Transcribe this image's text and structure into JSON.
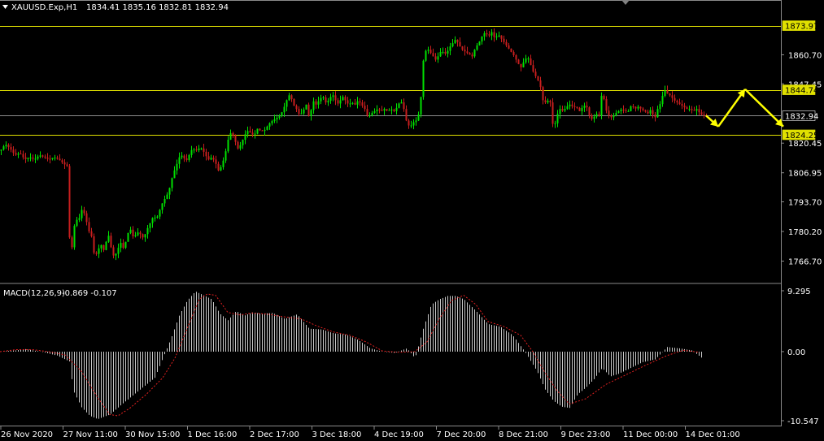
{
  "chart_header": {
    "symbol_info": "XAUUSD.Exp,H1",
    "ohlc": "1834.41 1835.16 1832.81 1832.94"
  },
  "indicator_header": {
    "label": "MACD(12,26,9)",
    "values": "-0.869 -0.107"
  },
  "colors": {
    "background": "#000000",
    "bull": "#00e000",
    "bear": "#c81e1e",
    "level_line": "#e0e000",
    "price_line": "#8a8a8a",
    "arrow": "#ffff00",
    "macd_hist": "#c8c8c8",
    "macd_signal": "#e02020",
    "axis_text": "#ffffff"
  },
  "chart_data": [
    {
      "type": "candlestick",
      "title": "XAUUSD.Exp,H1",
      "ylim": [
        1758,
        1879
      ],
      "y_ticks": [
        "1860.70",
        "1847.45",
        "1820.45",
        "1806.95",
        "1793.70",
        "1780.20",
        "1766.70"
      ],
      "x_ticks": [
        "26 Nov 2020",
        "27 Nov 11:00",
        "30 Nov 15:00",
        "1 Dec 16:00",
        "2 Dec 17:00",
        "3 Dec 18:00",
        "4 Dec 19:00",
        "7 Dec 20:00",
        "8 Dec 21:00",
        "9 Dec 23:00",
        "11 Dec 00:00",
        "14 Dec 01:00"
      ],
      "level_tags": [
        {
          "label": "1873.97",
          "value": 1873.97,
          "style": "level"
        },
        {
          "label": "1844.74",
          "value": 1844.74,
          "style": "level"
        },
        {
          "label": "1832.94",
          "value": 1832.94,
          "style": "current"
        },
        {
          "label": "1824.25",
          "value": 1824.25,
          "style": "level"
        }
      ],
      "price_path": [
        [
          0,
          1817
        ],
        [
          6,
          1820
        ],
        [
          12,
          1818
        ],
        [
          18,
          1815
        ],
        [
          24,
          1816
        ],
        [
          30,
          1813
        ],
        [
          36,
          1814
        ],
        [
          42,
          1813
        ],
        [
          48,
          1815
        ],
        [
          54,
          1814
        ],
        [
          60,
          1813
        ],
        [
          66,
          1814
        ],
        [
          72,
          1813
        ],
        [
          78,
          1811
        ],
        [
          82,
          1810
        ],
        [
          84,
          1779
        ],
        [
          88,
          1773
        ],
        [
          92,
          1786
        ],
        [
          96,
          1785
        ],
        [
          100,
          1790
        ],
        [
          104,
          1788
        ],
        [
          108,
          1781
        ],
        [
          112,
          1778
        ],
        [
          116,
          1768
        ],
        [
          120,
          1772
        ],
        [
          124,
          1774
        ],
        [
          128,
          1771
        ],
        [
          132,
          1780
        ],
        [
          136,
          1773
        ],
        [
          140,
          1768
        ],
        [
          144,
          1772
        ],
        [
          148,
          1775
        ],
        [
          152,
          1772
        ],
        [
          156,
          1779
        ],
        [
          160,
          1781
        ],
        [
          164,
          1777
        ],
        [
          168,
          1780
        ],
        [
          172,
          1779
        ],
        [
          176,
          1777
        ],
        [
          180,
          1781
        ],
        [
          184,
          1784
        ],
        [
          188,
          1787
        ],
        [
          192,
          1786
        ],
        [
          196,
          1790
        ],
        [
          200,
          1794
        ],
        [
          204,
          1796
        ],
        [
          208,
          1800
        ],
        [
          212,
          1806
        ],
        [
          216,
          1810
        ],
        [
          220,
          1814
        ],
        [
          224,
          1815
        ],
        [
          228,
          1812
        ],
        [
          232,
          1815
        ],
        [
          236,
          1818
        ],
        [
          240,
          1817
        ],
        [
          244,
          1818
        ],
        [
          248,
          1818
        ],
        [
          252,
          1815
        ],
        [
          256,
          1813
        ],
        [
          260,
          1814
        ],
        [
          264,
          1812
        ],
        [
          268,
          1808
        ],
        [
          272,
          1810
        ],
        [
          276,
          1815
        ],
        [
          280,
          1822
        ],
        [
          284,
          1826
        ],
        [
          288,
          1822
        ],
        [
          292,
          1818
        ],
        [
          296,
          1820
        ],
        [
          300,
          1824
        ],
        [
          304,
          1826
        ],
        [
          308,
          1825
        ],
        [
          312,
          1824
        ],
        [
          316,
          1827
        ],
        [
          320,
          1826
        ],
        [
          324,
          1826
        ],
        [
          328,
          1828
        ],
        [
          332,
          1830
        ],
        [
          336,
          1831
        ],
        [
          340,
          1832
        ],
        [
          344,
          1833
        ],
        [
          348,
          1836
        ],
        [
          352,
          1840
        ],
        [
          356,
          1843
        ],
        [
          360,
          1838
        ],
        [
          364,
          1836
        ],
        [
          368,
          1833
        ],
        [
          372,
          1835
        ],
        [
          376,
          1838
        ],
        [
          380,
          1831
        ],
        [
          384,
          1840
        ],
        [
          388,
          1838
        ],
        [
          392,
          1840
        ],
        [
          396,
          1842
        ],
        [
          400,
          1839
        ],
        [
          404,
          1840
        ],
        [
          408,
          1843
        ],
        [
          412,
          1840
        ],
        [
          416,
          1838
        ],
        [
          420,
          1842
        ],
        [
          424,
          1840
        ],
        [
          428,
          1838
        ],
        [
          432,
          1839
        ],
        [
          436,
          1838
        ],
        [
          440,
          1840
        ],
        [
          444,
          1838
        ],
        [
          448,
          1836
        ],
        [
          452,
          1832
        ],
        [
          456,
          1834
        ],
        [
          460,
          1835
        ],
        [
          464,
          1836
        ],
        [
          468,
          1835
        ],
        [
          472,
          1836
        ],
        [
          476,
          1835
        ],
        [
          480,
          1836
        ],
        [
          484,
          1835
        ],
        [
          488,
          1837
        ],
        [
          492,
          1840
        ],
        [
          496,
          1836
        ],
        [
          500,
          1829
        ],
        [
          504,
          1828
        ],
        [
          508,
          1830
        ],
        [
          512,
          1831
        ],
        [
          516,
          1836
        ],
        [
          520,
          1858
        ],
        [
          524,
          1864
        ],
        [
          528,
          1862
        ],
        [
          532,
          1860
        ],
        [
          536,
          1858
        ],
        [
          540,
          1862
        ],
        [
          544,
          1862
        ],
        [
          548,
          1861
        ],
        [
          552,
          1864
        ],
        [
          556,
          1866
        ],
        [
          560,
          1868
        ],
        [
          564,
          1865
        ],
        [
          568,
          1863
        ],
        [
          572,
          1862
        ],
        [
          576,
          1861
        ],
        [
          580,
          1860
        ],
        [
          584,
          1864
        ],
        [
          588,
          1866
        ],
        [
          592,
          1869
        ],
        [
          596,
          1871
        ],
        [
          600,
          1869
        ],
        [
          604,
          1871
        ],
        [
          608,
          1868
        ],
        [
          612,
          1870
        ],
        [
          616,
          1868
        ],
        [
          620,
          1866
        ],
        [
          624,
          1864
        ],
        [
          628,
          1862
        ],
        [
          632,
          1860
        ],
        [
          636,
          1857
        ],
        [
          640,
          1855
        ],
        [
          644,
          1858
        ],
        [
          648,
          1860
        ],
        [
          652,
          1856
        ],
        [
          656,
          1852
        ],
        [
          660,
          1850
        ],
        [
          664,
          1846
        ],
        [
          668,
          1838
        ],
        [
          672,
          1840
        ],
        [
          676,
          1839
        ],
        [
          680,
          1826
        ],
        [
          684,
          1833
        ],
        [
          688,
          1836
        ],
        [
          692,
          1835
        ],
        [
          696,
          1837
        ],
        [
          700,
          1838
        ],
        [
          704,
          1837
        ],
        [
          708,
          1837
        ],
        [
          712,
          1835
        ],
        [
          716,
          1837
        ],
        [
          720,
          1838
        ],
        [
          724,
          1833
        ],
        [
          728,
          1831
        ],
        [
          732,
          1834
        ],
        [
          736,
          1833
        ],
        [
          740,
          1845
        ],
        [
          744,
          1836
        ],
        [
          748,
          1833
        ],
        [
          752,
          1832
        ],
        [
          756,
          1834
        ],
        [
          760,
          1835
        ],
        [
          764,
          1836
        ],
        [
          768,
          1835
        ],
        [
          772,
          1835
        ],
        [
          776,
          1838
        ],
        [
          780,
          1836
        ],
        [
          784,
          1837
        ],
        [
          788,
          1836
        ],
        [
          792,
          1835
        ],
        [
          796,
          1834
        ],
        [
          800,
          1836
        ],
        [
          804,
          1831
        ],
        [
          808,
          1836
        ],
        [
          812,
          1839
        ],
        [
          816,
          1845
        ],
        [
          820,
          1843
        ],
        [
          824,
          1842
        ],
        [
          828,
          1840
        ],
        [
          832,
          1839
        ],
        [
          836,
          1838
        ],
        [
          840,
          1837
        ],
        [
          844,
          1836
        ],
        [
          848,
          1836
        ],
        [
          852,
          1835
        ],
        [
          856,
          1836
        ],
        [
          860,
          1834
        ],
        [
          864,
          1833
        ],
        [
          868,
          1832.94
        ]
      ],
      "forecast_path": [
        [
          868,
          1833
        ],
        [
          883,
          1828
        ],
        [
          916,
          1845
        ],
        [
          963,
          1828
        ]
      ]
    },
    {
      "type": "macd",
      "title": "MACD(12,26,9)",
      "ylim": [
        -10.547,
        9.295
      ],
      "y_ticks": [
        "9.295",
        "0.00",
        "-10.547"
      ],
      "macd_path": [
        [
          0,
          0
        ],
        [
          20,
          0.2
        ],
        [
          30,
          0.4
        ],
        [
          50,
          0
        ],
        [
          70,
          -0.6
        ],
        [
          85,
          -1.5
        ],
        [
          90,
          -6
        ],
        [
          100,
          -8.5
        ],
        [
          110,
          -9.8
        ],
        [
          120,
          -10.3
        ],
        [
          135,
          -9.6
        ],
        [
          150,
          -8
        ],
        [
          170,
          -6
        ],
        [
          190,
          -4
        ],
        [
          200,
          -1
        ],
        [
          210,
          2
        ],
        [
          220,
          5.5
        ],
        [
          230,
          7.8
        ],
        [
          240,
          9.2
        ],
        [
          250,
          8.6
        ],
        [
          260,
          8
        ],
        [
          270,
          5.8
        ],
        [
          280,
          4.8
        ],
        [
          290,
          6.2
        ],
        [
          300,
          5.5
        ],
        [
          310,
          6
        ],
        [
          320,
          5.8
        ],
        [
          335,
          5.9
        ],
        [
          350,
          5
        ],
        [
          365,
          5.7
        ],
        [
          380,
          3.5
        ],
        [
          395,
          3.4
        ],
        [
          410,
          2.8
        ],
        [
          425,
          2.6
        ],
        [
          440,
          1.8
        ],
        [
          455,
          0.5
        ],
        [
          470,
          0
        ],
        [
          485,
          -0.2
        ],
        [
          500,
          0.5
        ],
        [
          510,
          -1
        ],
        [
          520,
          3.5
        ],
        [
          530,
          7.2
        ],
        [
          540,
          8
        ],
        [
          550,
          8.5
        ],
        [
          560,
          8.5
        ],
        [
          570,
          8
        ],
        [
          585,
          6.2
        ],
        [
          600,
          4.2
        ],
        [
          615,
          3.8
        ],
        [
          630,
          2.5
        ],
        [
          645,
          0
        ],
        [
          660,
          -3
        ],
        [
          670,
          -5.8
        ],
        [
          680,
          -7.5
        ],
        [
          690,
          -8.4
        ],
        [
          700,
          -8.6
        ],
        [
          710,
          -6.5
        ],
        [
          720,
          -5.5
        ],
        [
          730,
          -4.2
        ],
        [
          740,
          -2.5
        ],
        [
          750,
          -3.8
        ],
        [
          760,
          -3.4
        ],
        [
          775,
          -2.5
        ],
        [
          790,
          -1.6
        ],
        [
          805,
          -1.2
        ],
        [
          820,
          0.7
        ],
        [
          835,
          0.5
        ],
        [
          850,
          0.2
        ],
        [
          862,
          -0.9
        ]
      ],
      "signal_path": [
        [
          0,
          0
        ],
        [
          20,
          0.3
        ],
        [
          40,
          0.3
        ],
        [
          60,
          0
        ],
        [
          80,
          -0.5
        ],
        [
          100,
          -3
        ],
        [
          120,
          -7
        ],
        [
          135,
          -9.6
        ],
        [
          145,
          -9.8
        ],
        [
          160,
          -8.6
        ],
        [
          180,
          -6.5
        ],
        [
          200,
          -4
        ],
        [
          215,
          -1
        ],
        [
          230,
          3.5
        ],
        [
          245,
          8
        ],
        [
          255,
          8.8
        ],
        [
          265,
          8.6
        ],
        [
          280,
          6
        ],
        [
          295,
          5.6
        ],
        [
          310,
          5.9
        ],
        [
          330,
          5.7
        ],
        [
          350,
          5.3
        ],
        [
          370,
          5
        ],
        [
          390,
          3.9
        ],
        [
          410,
          3
        ],
        [
          430,
          2.5
        ],
        [
          450,
          1.5
        ],
        [
          470,
          0.1
        ],
        [
          490,
          -0.1
        ],
        [
          510,
          0
        ],
        [
          525,
          1.5
        ],
        [
          540,
          5
        ],
        [
          555,
          7.8
        ],
        [
          570,
          8.6
        ],
        [
          585,
          7.2
        ],
        [
          600,
          4.6
        ],
        [
          620,
          3.8
        ],
        [
          640,
          2.5
        ],
        [
          655,
          0
        ],
        [
          670,
          -3.2
        ],
        [
          685,
          -6
        ],
        [
          700,
          -8
        ],
        [
          720,
          -7.2
        ],
        [
          745,
          -5
        ],
        [
          770,
          -3.5
        ],
        [
          795,
          -2
        ],
        [
          820,
          -0.6
        ],
        [
          840,
          0.2
        ],
        [
          860,
          -0.1
        ]
      ]
    }
  ]
}
